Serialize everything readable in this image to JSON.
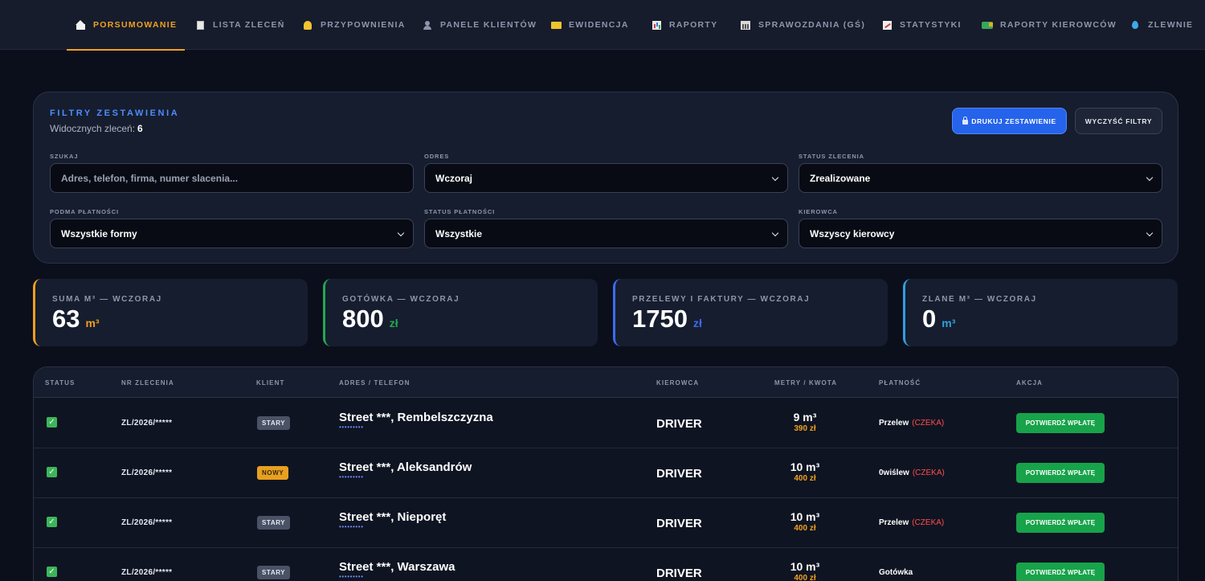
{
  "nav": {
    "items": [
      {
        "label": "PORSUMOWANIE",
        "icon": "home-icon"
      },
      {
        "label": "LISTA ZLECEŃ",
        "icon": "clipboard-icon"
      },
      {
        "label": "PRZYPOWNIENIA",
        "icon": "bell-icon"
      },
      {
        "label": "PANELE KLIENTÓW",
        "icon": "user-icon"
      },
      {
        "label": "EWIDENCJA",
        "icon": "folder-icon"
      },
      {
        "label": "RAPORTY",
        "icon": "bar-chart-icon"
      },
      {
        "label": "SPRAWOZDANIA (GŚ)",
        "icon": "bank-icon"
      },
      {
        "label": "STATYSTYKI",
        "icon": "trend-icon"
      },
      {
        "label": "RAPORTY KIEROWCÓW",
        "icon": "truck-icon"
      },
      {
        "label": "ZLEWNIE",
        "icon": "droplet-icon"
      }
    ],
    "active_index": 0,
    "accent_color": "#f0a020"
  },
  "filters": {
    "title": "FILTRY ZESTAWIENIA",
    "visible_label": "Widocznych zleceń:",
    "visible_count": "6",
    "print_label": "DRUKUJ ZESTAWIENIE",
    "clear_label": "WYCZYŚĆ FILTRY",
    "search_label": "SZUKAJ",
    "search_placeholder": "Adres, telefon, firma, numer slacenia...",
    "period_label": "ODRES",
    "period_value": "Wczoraj",
    "status_label": "STATUS ZLECENIA",
    "status_value": "Zrealizowane",
    "payment_form_label": "PODMA PŁATNOŚCI",
    "payment_form_value": "Wszystkie formy",
    "payment_status_label": "STATUS PŁATNOŚCI",
    "payment_status_value": "Wszystkie",
    "driver_label": "KIEROWCA",
    "driver_value": "Wszyscy kierowcy"
  },
  "stats": [
    {
      "label": "SUMA M³ — WCZORAJ",
      "value": "63",
      "unit": "m³",
      "color": "#f0a020"
    },
    {
      "label": "GOTÓWKA — WCZORAJ",
      "value": "800",
      "unit": "zł",
      "color": "#22a851"
    },
    {
      "label": "PRZELEWY I FAKTURY — WCZORAJ",
      "value": "1750",
      "unit": "zł",
      "color": "#3b6cf0"
    },
    {
      "label": "ZLANE M³ — WCZORAJ",
      "value": "0",
      "unit": "m³",
      "color": "#2f9fe0"
    }
  ],
  "table": {
    "headers": [
      "STATUS",
      "NR ZLECENIA",
      "KLIENT",
      "ADRES / TELEFON",
      "KIEROWCA",
      "METRY / KWOTA",
      "PŁATNOŚĆ",
      "AKCJA"
    ],
    "rows": [
      {
        "order_no": "ZL/2026/*****",
        "client": "STARY",
        "client_type": "old",
        "address": "Street ***, Rembelszczyzna",
        "phone": "•••••••••",
        "driver": "DRIVER",
        "meters": "9 m³",
        "amount": "390 zł",
        "payment": "Przelew",
        "payment_status": "(CZEKA)",
        "action": "POTWIERDŹ WPŁATĘ"
      },
      {
        "order_no": "ZL/2026/*****",
        "client": "NOWY",
        "client_type": "new",
        "address": "Street ***, Aleksandrów",
        "phone": "•••••••••",
        "driver": "DRIVER",
        "meters": "10 m³",
        "amount": "400 zł",
        "payment": "0wiślew",
        "payment_status": "(CZEKA)",
        "action": "POTWIERDŹ WPŁATĘ"
      },
      {
        "order_no": "ZL/2026/*****",
        "client": "STARY",
        "client_type": "old",
        "address": "Street ***, Nieporęt",
        "phone": "•••••••••",
        "driver": "DRIVER",
        "meters": "10 m³",
        "amount": "400 zł",
        "payment": "Przelew",
        "payment_status": "(CZEKA)",
        "action": "POTWIERDŹ WPŁATĘ"
      },
      {
        "order_no": "ZL/2026/*****",
        "client": "STARY",
        "client_type": "old",
        "address": "Street ***, Warszawa",
        "phone": "•••••••••",
        "driver": "DRIVER",
        "meters": "10 m³",
        "amount": "400 zł",
        "payment": "Gotówka",
        "payment_status": "",
        "action": "POTWIERDŹ WPŁATĘ"
      }
    ]
  }
}
